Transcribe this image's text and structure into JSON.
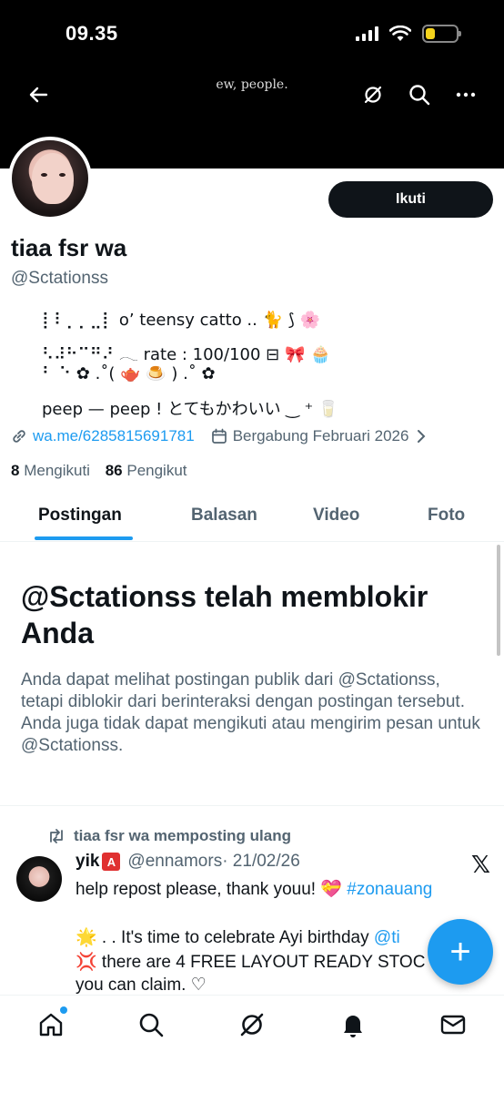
{
  "status_bar": {
    "time": "09.35",
    "battery_level": 0.3
  },
  "header": {
    "title": "ew, people.",
    "icons": [
      "back-arrow-icon",
      "grok-icon",
      "search-icon",
      "more-icon"
    ]
  },
  "profile": {
    "follow_label": "Ikuti",
    "name": "tiaa fsr wa",
    "handle": "@Sctationss",
    "bio_lines": [
      "⡇⠇⡀⡀⣀⡇ o’ teensy catto .. 🐈 ⟆ 🌸",
      "⠣⠼⠓⠉⠛⠜ 𓂃 rate : 100/100 ⊟ 🎀 🧁",
      "⠃        ⠑ ✿ .˚( 🫖 🍮 ) .˚ ✿",
      "peep — peep ! とてもかわいい ‿ ⁺ 🥛"
    ],
    "link": "wa.me/6285815691781",
    "joined": "Bergabung Februari 2026",
    "following_count": "8",
    "following_label": "Mengikuti",
    "followers_count": "86",
    "followers_label": "Pengikut"
  },
  "tabs": [
    {
      "label": "Postingan",
      "active": true
    },
    {
      "label": "Balasan",
      "active": false
    },
    {
      "label": "Video",
      "active": false
    },
    {
      "label": "Foto",
      "active": false
    }
  ],
  "blocked_notice": {
    "title": "@Sctationss telah memblokir Anda",
    "description": "Anda dapat melihat postingan publik dari @Sctationss, tetapi diblokir dari berinteraksi dengan postingan tersebut. Anda juga tidak dapat mengikuti atau mengirim pesan untuk @Sctationss."
  },
  "post": {
    "repost_label": "tiaa fsr wa memposting ulang",
    "author_name": "yik",
    "author_badge": "A",
    "author_handle": "@ennamors",
    "date": "· 21/02/26",
    "x_logo": "𝕏",
    "line1_text": "help repost please, thank youu! 💝 ",
    "line1_tag": "#zonauang",
    "line2_text": "🌟 . . It's time to celebrate Ayi birthday ",
    "line2_tag": "@ti",
    "line3_text": "💢 there are 4 FREE LAYOUT READY STOC",
    "line4_text": "you can claim. ♡"
  },
  "fab": {
    "label": "+"
  },
  "bottom_nav": {
    "items": [
      "home-icon",
      "search-icon",
      "grok-icon",
      "notifications-icon",
      "messages-icon"
    ]
  },
  "colors": {
    "accent": "#1d9bf0",
    "text": "#0f1419",
    "muted": "#536471",
    "header_bg": "#000000",
    "badge": "#e03030"
  }
}
